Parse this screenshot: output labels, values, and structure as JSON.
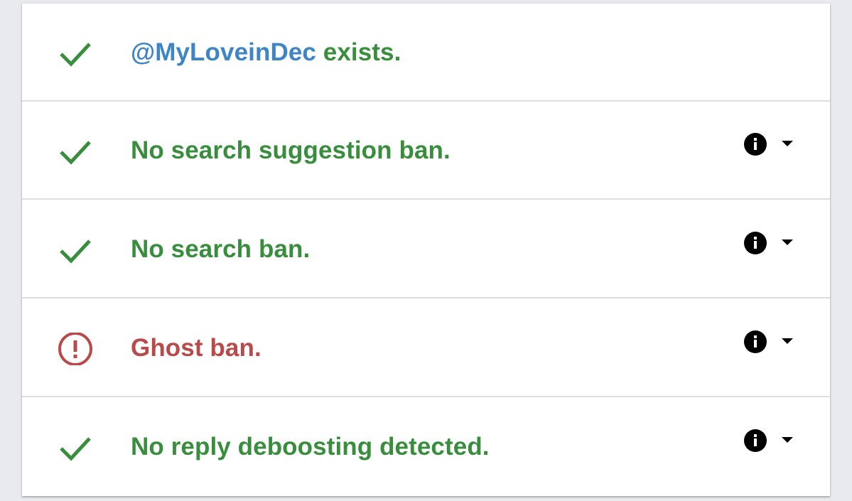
{
  "colors": {
    "ok": "#388e3c",
    "error": "#b84a4a",
    "handle": "#3d85c6",
    "background": "#e8eaee",
    "card": "#ffffff",
    "divider": "#dedede"
  },
  "results": [
    {
      "status": "ok",
      "icon": "check-icon",
      "handle": "@MyLoveinDec",
      "text": " exists.",
      "has_info": false
    },
    {
      "status": "ok",
      "icon": "check-icon",
      "text": "No search suggestion ban.",
      "has_info": true
    },
    {
      "status": "ok",
      "icon": "check-icon",
      "text": "No search ban.",
      "has_info": true
    },
    {
      "status": "error",
      "icon": "error-circle-icon",
      "text": "Ghost ban.",
      "has_info": true
    },
    {
      "status": "ok",
      "icon": "check-icon",
      "text": "No reply deboosting detected.",
      "has_info": true
    }
  ]
}
